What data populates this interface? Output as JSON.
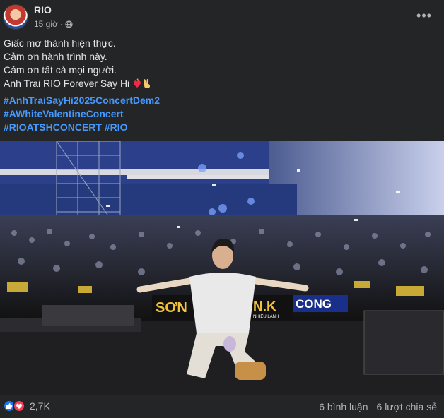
{
  "post": {
    "author": "RIO",
    "time": "15 giờ",
    "privacy_icon": "globe-icon",
    "more_label": "•••",
    "lines": [
      "Giấc mơ thành hiện thực.",
      "Cảm ơn hành trình này.",
      "Cảm ơn tất cả mọi người.",
      "Anh Trai RIO Forever Say Hi"
    ],
    "line_emojis": [
      "fire-heart-icon",
      "victory-hand-icon"
    ],
    "hashtags": {
      "line1": "#AnhTraiSayHi2025ConcertDem2",
      "line2": "#AWhiteValentineConcert",
      "line3a": "#RIOATSHCONCERT",
      "line3b": "#RIO"
    },
    "photo": {
      "stage_signs": [
        "SƠN",
        "N.K",
        "CONG"
      ],
      "sign_sub": "NHIỀU LÀNH"
    },
    "footer": {
      "reaction_icons": [
        "like-icon",
        "love-icon"
      ],
      "reaction_count": "2,7K",
      "comments": "6 bình luận",
      "shares": "6 lượt chia sẻ"
    },
    "colors": {
      "background": "#242526",
      "text": "#e4e6eb",
      "secondary": "#b0b3b8",
      "link": "#4599ff",
      "like": "#1877f2",
      "love": "#f33e58"
    }
  }
}
